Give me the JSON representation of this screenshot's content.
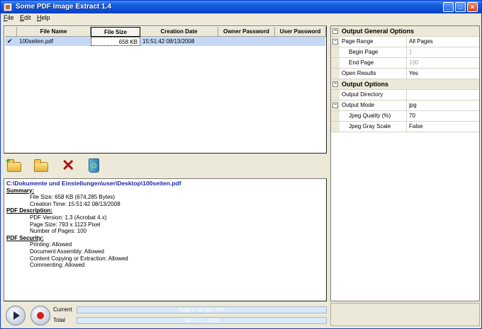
{
  "window": {
    "title": "Some PDF Image Extract 1.4"
  },
  "menu": [
    "File",
    "Edit",
    "Help"
  ],
  "table": {
    "columns": [
      "File Name",
      "File Size",
      "Creation Date",
      "Owner Password",
      "User Password"
    ],
    "rows": [
      {
        "checked": true,
        "name": "100seiten.pdf",
        "size": "658 KB",
        "date": "15:51:42 08/13/2008",
        "owner": "",
        "user": ""
      }
    ]
  },
  "toolbar_icons": [
    "add-folder-icon",
    "open-folder-icon",
    "delete-icon",
    "recycle-icon"
  ],
  "info": {
    "path": "C:\\Dokumente und Einstellungen\\user\\Desktop\\100seiten.pdf",
    "summary_heading": "Summary:",
    "summary": [
      "File Size: 658 KB (674,285 Bytes)",
      "Creation Time: 15:51:42 08/13/2008"
    ],
    "description_heading": "PDF Description:",
    "description": [
      "PDF Version: 1.3 (Acrobat 4.x)",
      "Page Size: 793 x 1123 Pixel",
      "Number of Pages: 100"
    ],
    "security_heading": "PDF Security:",
    "security": [
      "Printing: Allowed",
      "Document Assembly: Allowed",
      "Content Copying or Extraction: Allowed",
      "Commenting: Allowed"
    ]
  },
  "progress": {
    "current_label": "Current",
    "current_text": "Page 47 of 100, 45%",
    "total_label": "Total",
    "total_text": "File 1 of 1, 100%"
  },
  "properties": {
    "general_heading": "Output General Options",
    "page_range_label": "Page Range",
    "page_range_value": "All Pages",
    "begin_page_label": "Begin Page",
    "begin_page_value": "1",
    "end_page_label": "End Page",
    "end_page_value": "100",
    "open_results_label": "Open Results",
    "open_results_value": "Yes",
    "output_heading": "Output Options",
    "output_dir_label": "Output Directory",
    "output_dir_value": "",
    "output_mode_label": "Output Mode",
    "output_mode_value": "jpg",
    "jpeg_quality_label": "Jpeg Quality (%)",
    "jpeg_quality_value": "70",
    "jpeg_gray_label": "Jpeg Gray Scale",
    "jpeg_gray_value": "False"
  },
  "colors": {
    "titlebar": "#0b4fd8",
    "selection": "#c5d9f7",
    "path_text": "#1a2aa0",
    "delete": "#b01010"
  }
}
